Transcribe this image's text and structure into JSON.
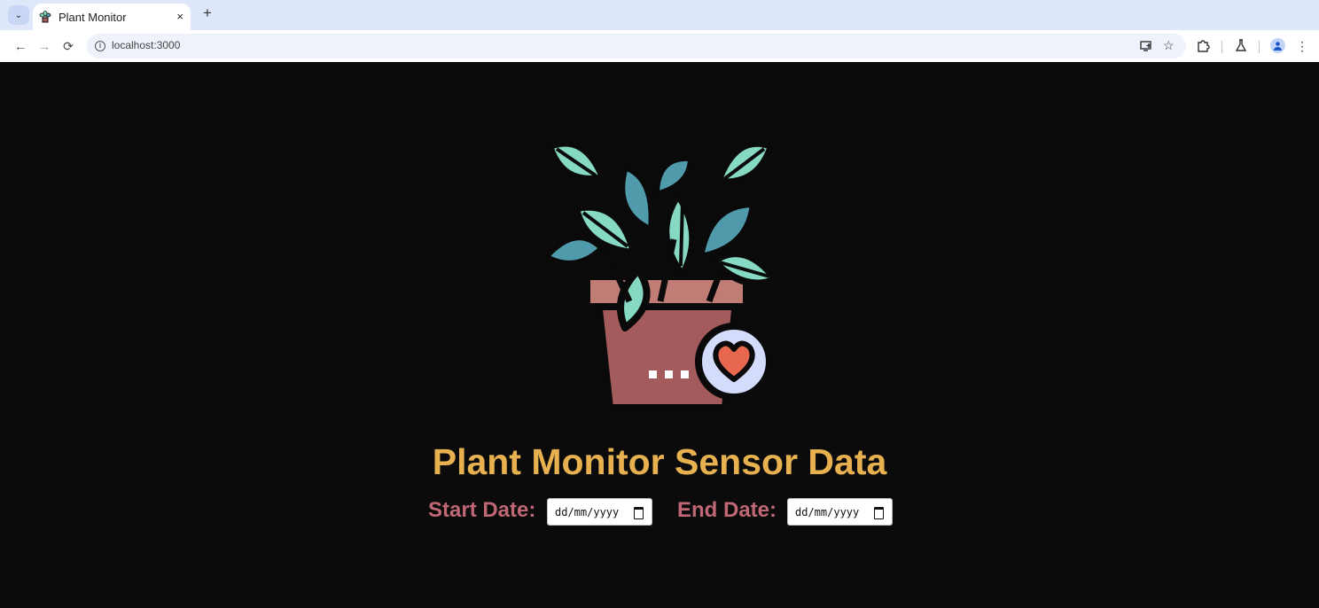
{
  "browser": {
    "tab": {
      "title": "Plant Monitor",
      "favicon": "plant-favicon",
      "close": "×"
    },
    "tab_menu": "⌄",
    "new_tab": "+",
    "nav": {
      "back": "←",
      "forward": "→",
      "reload": "⟳"
    },
    "address": {
      "url": "localhost:3000"
    },
    "icons": [
      "install-app-icon",
      "bookmark-star-icon",
      "extensions-icon",
      "labs-flask-icon",
      "profile-avatar-icon",
      "menu-kebab-icon"
    ]
  },
  "page": {
    "hero_icon": "potted-plant-with-heart-icon",
    "title": "Plant Monitor Sensor Data",
    "start_label": "Start Date:",
    "end_label": "End Date:",
    "start_value": "dd/mm/yyyy",
    "end_value": "dd/mm/yyyy"
  },
  "colors": {
    "background": "#0b0b0b",
    "title": "#e8b14f",
    "label": "#bf6774",
    "leaf_light": "#86d9c2",
    "leaf_dark": "#4f9aab",
    "pot": "#a35b5b",
    "heart": "#e8684f"
  }
}
